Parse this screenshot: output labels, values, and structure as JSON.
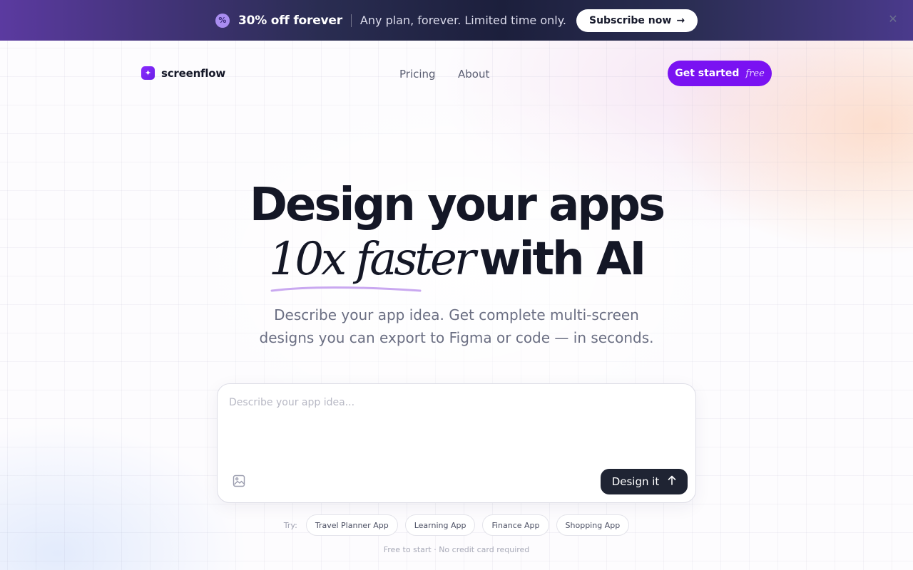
{
  "promo": {
    "badge_icon": "percent-badge-icon",
    "title": "30% off forever",
    "text": "Any plan, forever. Limited time only.",
    "cta_label": "Subscribe now",
    "cta_icon": "arrow-right-icon",
    "close_icon": "close-icon"
  },
  "nav": {
    "brand_name": "screenflow",
    "links": [
      "Pricing",
      "About"
    ],
    "cta_label": "Get started",
    "cta_badge": "free",
    "accent": "#7a12f2"
  },
  "hero": {
    "line1": "Design your apps",
    "line2_italic": "10x faster",
    "line2_rest": "with AI",
    "subtitle_line1": "Describe your app idea. Get complete multi-screen",
    "subtitle_line2": "designs you can export to Figma or code — in seconds."
  },
  "prompt": {
    "placeholder": "Describe your app idea...",
    "value": "",
    "upload_icon": "image-upload-icon",
    "submit_label": "Design it",
    "submit_icon": "arrow-up-icon"
  },
  "suggestions": {
    "label": "Try:",
    "chips": [
      "Travel Planner App",
      "Learning App",
      "Finance App",
      "Shopping App"
    ]
  },
  "footnote": "Free to start · No credit card required"
}
